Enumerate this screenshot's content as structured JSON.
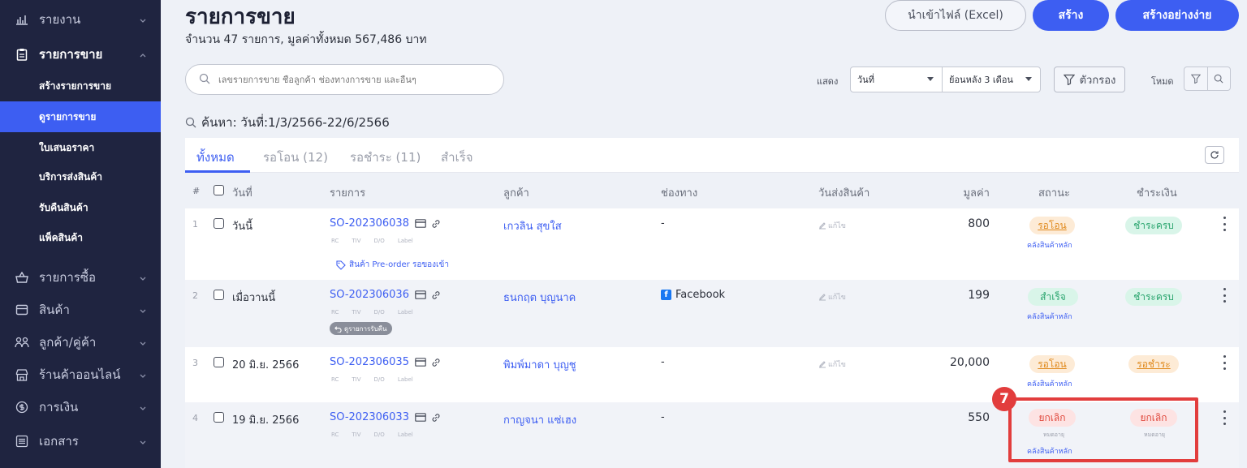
{
  "sidebar": {
    "items": [
      {
        "label": "รายงาน",
        "icon": "bar-chart-icon"
      },
      {
        "label": "รายการขาย",
        "icon": "clipboard-icon"
      },
      {
        "label": "รายการซื้อ",
        "icon": "basket-icon"
      },
      {
        "label": "สินค้า",
        "icon": "box-icon"
      },
      {
        "label": "ลูกค้า/คู่ค้า",
        "icon": "users-icon"
      },
      {
        "label": "ร้านค้าออนไลน์",
        "icon": "store-icon"
      },
      {
        "label": "การเงิน",
        "icon": "dollar-icon"
      },
      {
        "label": "เอกสาร",
        "icon": "document-icon"
      }
    ],
    "sub_items": [
      "สร้างรายการขาย",
      "ดูรายการขาย",
      "ใบเสนอราคา",
      "บริการส่งสินค้า",
      "รับคืนสินค้า",
      "แพ็คสินค้า"
    ]
  },
  "header": {
    "title": "รายการขาย",
    "summary": "จำนวน 47 รายการ, มูลค่าทั้งหมด 567,486 บาท",
    "import_label": "นำเข้าไฟล์ (Excel)",
    "create_label": "สร้าง",
    "create_simple_label": "สร้างอย่างง่าย"
  },
  "search": {
    "placeholder": "เลขรายการขาย ชื่อลูกค้า ช่องทางการขาย และอื่นๆ"
  },
  "filters": {
    "show_label": "แสดง",
    "date_field": "วันที่",
    "range": "ย้อนหลัง 3 เดือน",
    "filter_label": "ตัวกรอง",
    "mode_label": "โหมด"
  },
  "search_query": "ค้นหา: วันที่:1/3/2566-22/6/2566",
  "tabs": [
    {
      "label": "ทั้งหมด"
    },
    {
      "label": "รอโอน (12)"
    },
    {
      "label": "รอชำระ (11)"
    },
    {
      "label": "สำเร็จ"
    }
  ],
  "columns": {
    "num": "#",
    "date": "วันที่",
    "order": "รายการ",
    "customer": "ลูกค้า",
    "channel": "ช่องทาง",
    "ship_date": "วันส่งสินค้า",
    "value": "มูลค่า",
    "status": "สถานะ",
    "payment": "ชำระเงิน"
  },
  "tag_labels": [
    "RC",
    "TIV",
    "D/O",
    "Label"
  ],
  "edit_label": "แก้ไข",
  "rows": [
    {
      "num": "1",
      "date": "วันนี้",
      "order": "SO-202306038",
      "customer": "เกวลิน สุขใส",
      "channel": "-",
      "ship": "แก้ไข",
      "value": "800",
      "status": "รอโอน",
      "warehouse": "คลังสินค้าหลัก",
      "payment": "ชำระครบ",
      "note": "สินค้า Pre-order รอของเข้า"
    },
    {
      "num": "2",
      "date": "เมื่อวานนี้",
      "order": "SO-202306036",
      "customer": "ธนกฤต บุญนาค",
      "channel": "Facebook",
      "ship": "แก้ไข",
      "value": "199",
      "status": "สำเร็จ",
      "warehouse": "คลังสินค้าหลัก",
      "payment": "ชำระครบ",
      "note": "ดูรายการรับคืน"
    },
    {
      "num": "3",
      "date": "20 มิ.ย. 2566",
      "order": "SO-202306035",
      "customer": "พิมพ์มาดา บุญชู",
      "channel": "-",
      "ship": "แก้ไข",
      "value": "20,000",
      "status": "รอโอน",
      "warehouse": "คลังสินค้าหลัก",
      "payment": "รอชำระ"
    },
    {
      "num": "4",
      "date": "19 มิ.ย. 2566",
      "order": "SO-202306033",
      "customer": "กาญจนา แซ่เฮง",
      "channel": "-",
      "value": "550",
      "status": "ยกเลิก",
      "status_sub": "หมดอายุ",
      "warehouse": "คลังสินค้าหลัก",
      "payment": "ยกเลิก",
      "payment_sub": "หมดอายุ"
    }
  ],
  "annotation": {
    "step": "7",
    "color": "#e23d3d"
  },
  "colors": {
    "accent": "#3d5ef2",
    "sidebar": "#1f2440"
  }
}
